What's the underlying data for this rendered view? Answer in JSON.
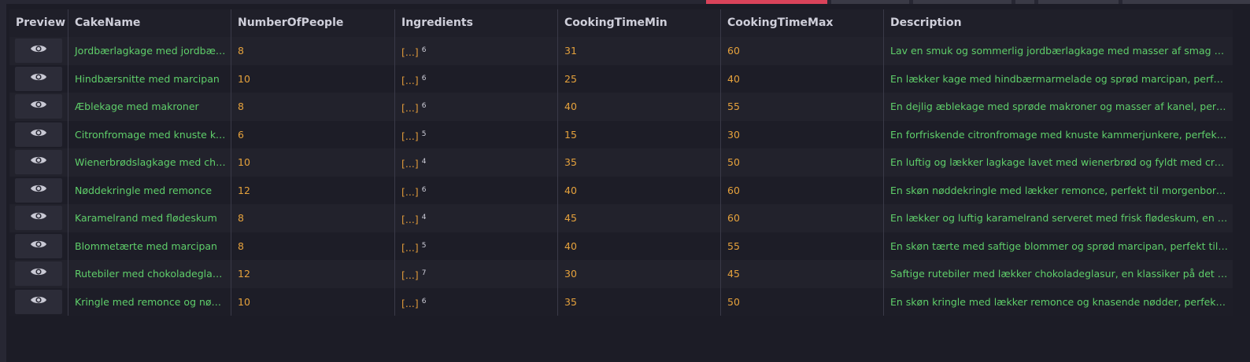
{
  "top_tabs": [
    {
      "color": "#d9435a"
    },
    {
      "color": "#3a3a46"
    },
    {
      "color": "#3a3a46"
    },
    {
      "color": "#3a3a46"
    },
    {
      "color": "#3a3a46"
    },
    {
      "color": "#3a3a46"
    }
  ],
  "columns": [
    "Preview",
    "CakeName",
    "NumberOfPeople",
    "Ingredients",
    "CookingTimeMin",
    "CookingTimeMax",
    "Description"
  ],
  "colors": {
    "name": "#5fcf6a",
    "number": "#e6a23c",
    "description": "#5fcf6a",
    "accent": "#d9435a"
  },
  "rows": [
    {
      "preview_icon": "eye-icon",
      "name": "Jordbærlagkage med jordbærcreme",
      "people": "8",
      "ingredients_label": "[...]",
      "ingredients_count": "6",
      "min": "31",
      "max": "60",
      "description": "Lav en smuk og sommerlig jordbærlagkage med masser af smag af friske jordbær"
    },
    {
      "preview_icon": "eye-icon",
      "name": "Hindbærsnitte med marcipan",
      "people": "10",
      "ingredients_label": "[...]",
      "ingredients_count": "6",
      "min": "25",
      "max": "40",
      "description": "En lækker kage med hindbærmarmelade og sprød marcipan, perfekt til kaffen"
    },
    {
      "preview_icon": "eye-icon",
      "name": "Æblekage med makroner",
      "people": "8",
      "ingredients_label": "[...]",
      "ingredients_count": "6",
      "min": "40",
      "max": "55",
      "description": "En dejlig æblekage med sprøde makroner og masser af kanel, perfekt til efteråret"
    },
    {
      "preview_icon": "eye-icon",
      "name": "Citronfromage med knuste kammerjunkere",
      "people": "6",
      "ingredients_label": "[...]",
      "ingredients_count": "5",
      "min": "15",
      "max": "30",
      "description": "En forfriskende citronfromage med knuste kammerjunkere, perfekt til sommeren"
    },
    {
      "preview_icon": "eye-icon",
      "name": "Wienerbrødslagkage med chokolade",
      "people": "10",
      "ingredients_label": "[...]",
      "ingredients_count": "4",
      "min": "35",
      "max": "50",
      "description": "En luftig og lækker lagkage lavet med wienerbrød og fyldt med cremet chokolade"
    },
    {
      "preview_icon": "eye-icon",
      "name": "Nøddekringle med remonce",
      "people": "12",
      "ingredients_label": "[...]",
      "ingredients_count": "6",
      "min": "40",
      "max": "60",
      "description": "En skøn nøddekringle med lækker remonce, perfekt til morgenbordet eller kaffen"
    },
    {
      "preview_icon": "eye-icon",
      "name": "Karamelrand med flødeskum",
      "people": "8",
      "ingredients_label": "[...]",
      "ingredients_count": "4",
      "min": "45",
      "max": "60",
      "description": "En lækker og luftig karamelrand serveret med frisk flødeskum, en sød og blød dessert"
    },
    {
      "preview_icon": "eye-icon",
      "name": "Blommetærte med marcipan",
      "people": "8",
      "ingredients_label": "[...]",
      "ingredients_count": "5",
      "min": "40",
      "max": "55",
      "description": "En skøn tærte med saftige blommer og sprød marcipan, perfekt til en sensommerdag"
    },
    {
      "preview_icon": "eye-icon",
      "name": "Rutebiler med chokoladeglasur",
      "people": "12",
      "ingredients_label": "[...]",
      "ingredients_count": "7",
      "min": "30",
      "max": "45",
      "description": "Saftige rutebiler med lækker chokoladeglasur, en klassiker på det søde bord"
    },
    {
      "preview_icon": "eye-icon",
      "name": "Kringle med remonce og nødder",
      "people": "10",
      "ingredients_label": "[...]",
      "ingredients_count": "6",
      "min": "35",
      "max": "50",
      "description": "En skøn kringle med lækker remonce og knasende nødder, perfekt til enhver lejlighed"
    }
  ]
}
